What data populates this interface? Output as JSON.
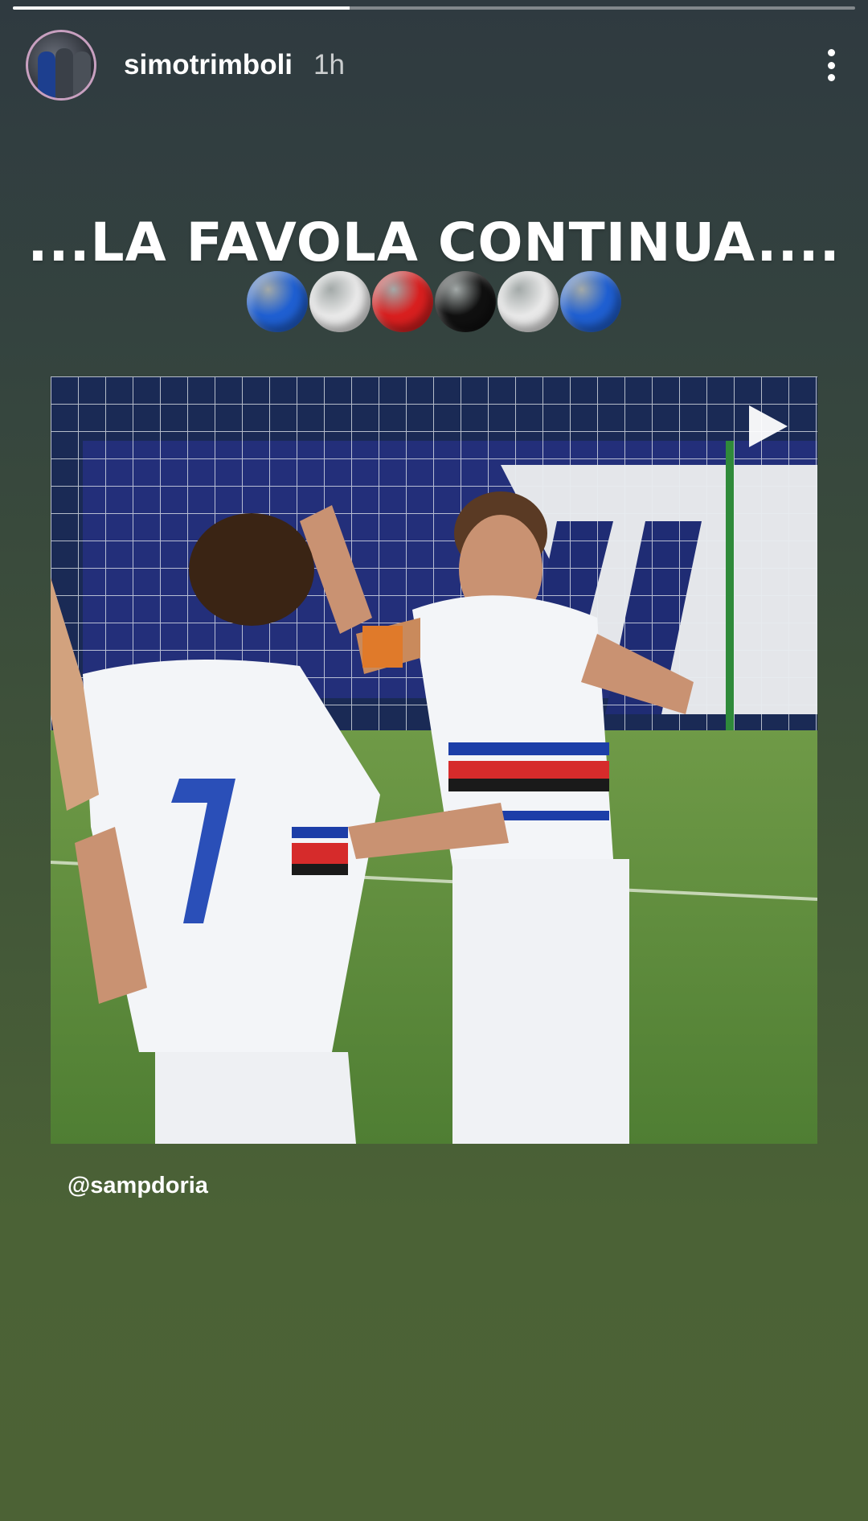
{
  "story": {
    "progress": 0.4,
    "username": "simotrimboli",
    "time": "1h",
    "caption": "...LA FAVOLA CONTINUA....",
    "mention": "@sampdoria",
    "emoji_balls": [
      {
        "name": "blue-circle-icon",
        "color": "#1f5fd1"
      },
      {
        "name": "white-circle-icon",
        "color": "#e8e8e8"
      },
      {
        "name": "red-circle-icon",
        "color": "#d81f1f"
      },
      {
        "name": "black-circle-icon",
        "color": "#101010"
      },
      {
        "name": "white-circle-icon",
        "color": "#e8e8e8"
      },
      {
        "name": "blue-circle-icon",
        "color": "#1f5fd1"
      }
    ],
    "shirt_number": "7"
  },
  "icons": {
    "more": "more-options-icon",
    "play": "play-icon"
  }
}
